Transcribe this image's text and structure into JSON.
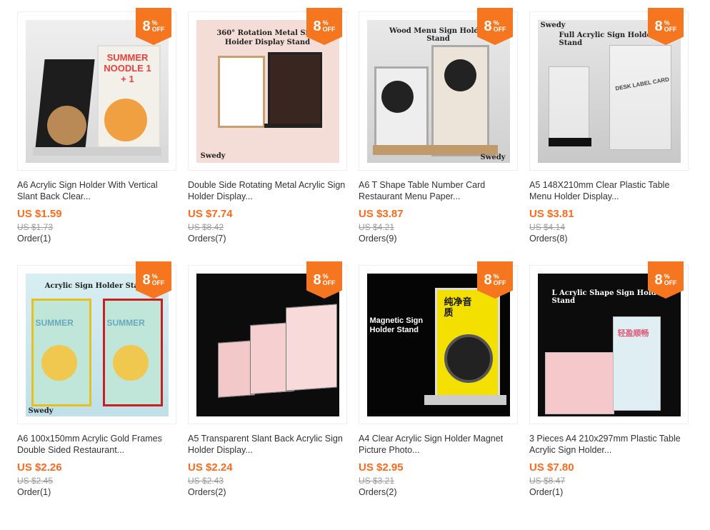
{
  "badge": {
    "num": "8",
    "pct": "%",
    "off": "OFF"
  },
  "products": [
    {
      "title": "A6 Acrylic Sign Holder With Vertical Slant Back Clear...",
      "price": "US $1.59",
      "old_price": "US $1.73",
      "orders": "Order(1)",
      "art_label": "",
      "brand": "",
      "art_text": "SUMMER NOODLE 1 + 1"
    },
    {
      "title": "Double Side Rotating Metal Acrylic Sign Holder Display...",
      "price": "US $7.74",
      "old_price": "US $8.42",
      "orders": "Orders(7)",
      "art_label": "360° Rotation Metal Sign Hoider Display Stand",
      "brand": "Swedy",
      "art_text": ""
    },
    {
      "title": "A6 T Shape Table Number Card Restaurant Menu Paper...",
      "price": "US $3.87",
      "old_price": "US $4.21",
      "orders": "Orders(9)",
      "art_label": "Wood Menu Sign Holder Stand",
      "brand": "Swedy",
      "art_text": ""
    },
    {
      "title": "A5 148X210mm Clear Plastic Table Menu Holder Display...",
      "price": "US $3.81",
      "old_price": "US $4.14",
      "orders": "Orders(8)",
      "art_label": "Full Acrylic Sign Holder Stand",
      "brand": "Swedy",
      "art_text": "DESK LABEL CARD"
    },
    {
      "title": "A6 100x150mm Acrylic Gold Frames Double Sided Restaurant...",
      "price": "US $2.26",
      "old_price": "US $2.45",
      "orders": "Order(1)",
      "art_label": "Acrylic Sign Holder Stand",
      "brand": "Swedy",
      "art_text": "SUMMER"
    },
    {
      "title": "A5 Transparent Slant Back Acrylic Sign Holder Display...",
      "price": "US $2.24",
      "old_price": "US $2.43",
      "orders": "Orders(2)",
      "art_label": "",
      "brand": "",
      "art_text": ""
    },
    {
      "title": "A4 Clear Acrylic Sign Holder Magnet Picture Photo...",
      "price": "US $2.95",
      "old_price": "US $3.21",
      "orders": "Orders(2)",
      "art_label": "Magnetic Sign Holder Stand",
      "brand": "",
      "art_text": "纯净音质"
    },
    {
      "title": "3 Pieces A4 210x297mm Plastic Table Acrylic Sign Holder...",
      "price": "US $7.80",
      "old_price": "US $8.47",
      "orders": "Order(1)",
      "art_label": "L Acrylic Shape Sign Holder Stand",
      "brand": "",
      "art_text": "轻盈顺畅"
    }
  ],
  "colors": {
    "accent": "#f5761f",
    "price": "#ff6a1a"
  }
}
